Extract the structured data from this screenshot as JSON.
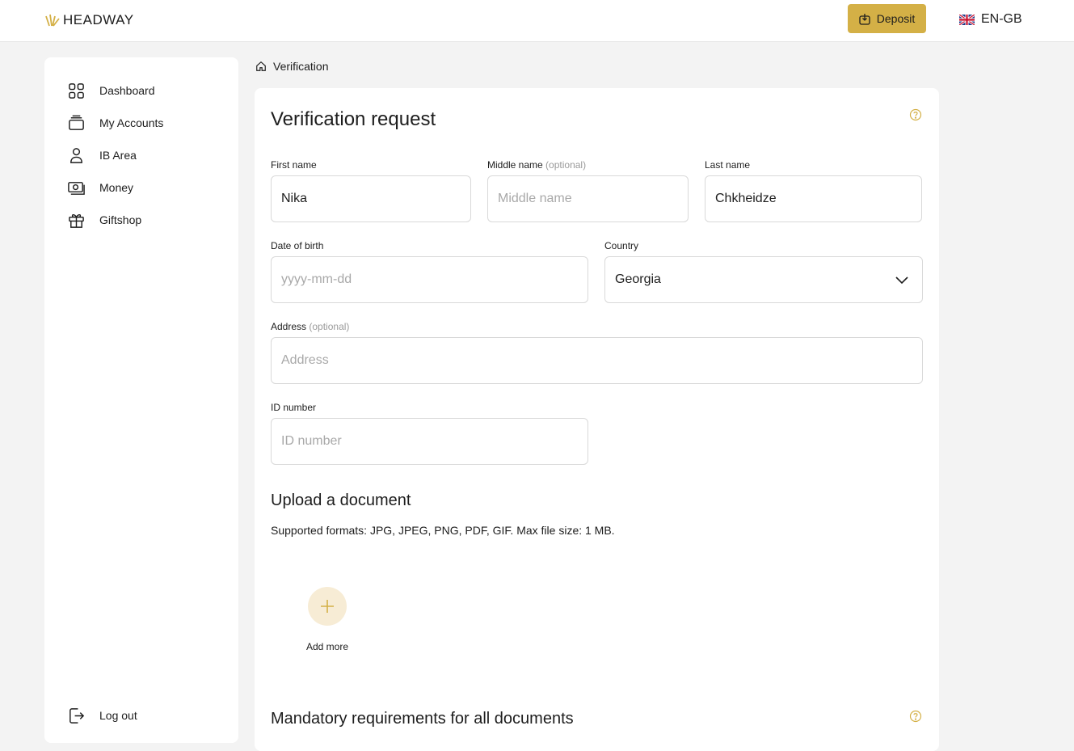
{
  "header": {
    "logo_text": "HEADWAY",
    "deposit_label": "Deposit",
    "language": "EN-GB"
  },
  "sidebar": {
    "items": [
      {
        "label": "Dashboard",
        "icon": "dashboard-grid-icon"
      },
      {
        "label": "My Accounts",
        "icon": "accounts-stack-icon"
      },
      {
        "label": "IB Area",
        "icon": "user-icon"
      },
      {
        "label": "Money",
        "icon": "banknote-icon"
      },
      {
        "label": "Giftshop",
        "icon": "gift-icon"
      }
    ],
    "logout_label": "Log out"
  },
  "breadcrumb": {
    "current": "Verification"
  },
  "form": {
    "title": "Verification request",
    "first_name": {
      "label": "First name",
      "value": "Nika"
    },
    "middle_name": {
      "label": "Middle name",
      "optional": "(optional)",
      "placeholder": "Middle name"
    },
    "last_name": {
      "label": "Last name",
      "value": "Chkheidze"
    },
    "dob": {
      "label": "Date of birth",
      "placeholder": "yyyy-mm-dd"
    },
    "country": {
      "label": "Country",
      "value": "Georgia"
    },
    "address": {
      "label": "Address",
      "optional": "(optional)",
      "placeholder": "Address"
    },
    "id_number": {
      "label": "ID number",
      "placeholder": "ID number"
    }
  },
  "upload": {
    "title": "Upload a document",
    "formats": "Supported formats: JPG, JPEG, PNG, PDF, GIF. Max file size: 1 MB.",
    "add_more": "Add more"
  },
  "requirements": {
    "title": "Mandatory requirements for all documents"
  },
  "colors": {
    "accent": "#d4b046",
    "accent_light": "#f7ecd5",
    "background": "#f3f3f3"
  }
}
